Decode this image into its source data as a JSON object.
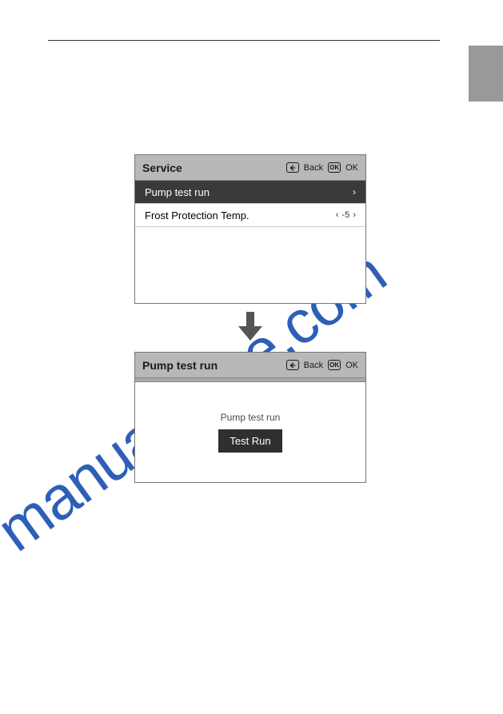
{
  "watermark": "manualshive.com",
  "header_buttons": {
    "back": "Back",
    "ok": "OK",
    "ok_icon": "OK"
  },
  "screen1": {
    "title": "Service",
    "rows": [
      {
        "label": "Pump test run",
        "chevron": "›"
      },
      {
        "label": "Frost Protection Temp.",
        "left_chev": "‹",
        "value": "-5",
        "right_chev": "›"
      }
    ]
  },
  "screen2": {
    "title": "Pump test run",
    "body_label": "Pump test run",
    "button": "Test Run"
  }
}
